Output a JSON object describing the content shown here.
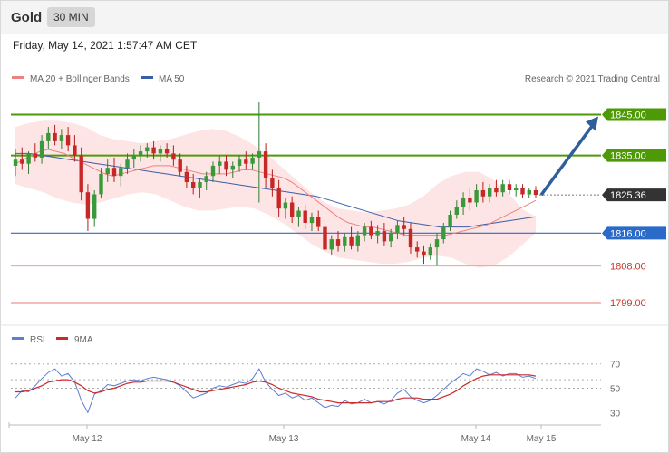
{
  "header": {
    "asset": "Gold",
    "timeframe": "30 MIN",
    "timestamp": "Friday, May 14, 2021 1:57:47 AM CET"
  },
  "legend": {
    "ma20": "MA 20 + Bollinger Bands",
    "ma50": "MA 50",
    "copyright": "Research © 2021 Trading Central",
    "rsi": "RSI",
    "ma9": "9MA"
  },
  "colors": {
    "resistance": "#4e9a06",
    "support": "#2a6ac8",
    "extra_support": "#d9534f",
    "ma20": "#f08080",
    "ma50": "#3b5ea8",
    "bollinger": "#fde0e0",
    "current": "#333333",
    "arrow": "#2f5f9a",
    "rsi": "#5b7fd1",
    "rsi_ma": "#cc2a2a"
  },
  "chart_data": [
    {
      "type": "candlestick",
      "title": "",
      "ylim": [
        1795,
        1852
      ],
      "x_ticks": [
        "May 12",
        "May 13",
        "May 14",
        "May 15"
      ],
      "levels": [
        {
          "label": "1845.00",
          "value": 1845.0,
          "kind": "resistance"
        },
        {
          "label": "1835.00",
          "value": 1835.0,
          "kind": "resistance"
        },
        {
          "label": "1825.36",
          "value": 1825.36,
          "kind": "current"
        },
        {
          "label": "1816.00",
          "value": 1816.0,
          "kind": "support"
        },
        {
          "label": "1808.00",
          "value": 1808.0,
          "kind": "extra_support"
        },
        {
          "label": "1799.00",
          "value": 1799.0,
          "kind": "extra_support"
        }
      ],
      "ohlc": [
        [
          1832.5,
          1836.5,
          1830,
          1834
        ],
        [
          1834,
          1837,
          1831.5,
          1833
        ],
        [
          1833,
          1836,
          1830.5,
          1835.5
        ],
        [
          1835.5,
          1838,
          1833.5,
          1834.5
        ],
        [
          1834.5,
          1840,
          1833,
          1838.5
        ],
        [
          1838.5,
          1842,
          1836.5,
          1840.5
        ],
        [
          1840.5,
          1842.5,
          1837.5,
          1838.5
        ],
        [
          1838.5,
          1841.5,
          1836.5,
          1840
        ],
        [
          1840,
          1842,
          1836,
          1837.5
        ],
        [
          1837.5,
          1840,
          1833.5,
          1835
        ],
        [
          1835,
          1837,
          1824,
          1826
        ],
        [
          1826,
          1828,
          1816.5,
          1819.5
        ],
        [
          1819.5,
          1826.5,
          1817.5,
          1825.5
        ],
        [
          1825.5,
          1832,
          1824.5,
          1830.5
        ],
        [
          1830.5,
          1834,
          1828.5,
          1832
        ],
        [
          1832,
          1834.5,
          1828.5,
          1830
        ],
        [
          1830,
          1833,
          1827.5,
          1832
        ],
        [
          1832,
          1835.5,
          1830.5,
          1834
        ],
        [
          1834,
          1836.5,
          1832,
          1835
        ],
        [
          1835,
          1837.5,
          1833.5,
          1836
        ],
        [
          1836,
          1838,
          1834.5,
          1837
        ],
        [
          1837,
          1838.5,
          1834,
          1835.5
        ],
        [
          1835.5,
          1837.5,
          1833.5,
          1836.5
        ],
        [
          1836.5,
          1838,
          1834.5,
          1835.5
        ],
        [
          1835.5,
          1837.5,
          1832.5,
          1834
        ],
        [
          1834,
          1835.5,
          1830,
          1831
        ],
        [
          1831,
          1832.5,
          1827,
          1828.5
        ],
        [
          1828.5,
          1830.5,
          1825.5,
          1827
        ],
        [
          1827,
          1829.5,
          1824.5,
          1828.5
        ],
        [
          1828.5,
          1831,
          1826.5,
          1830
        ],
        [
          1830,
          1833.5,
          1828.5,
          1832.5
        ],
        [
          1832.5,
          1835,
          1830.5,
          1833.5
        ],
        [
          1833.5,
          1835,
          1830,
          1831.5
        ],
        [
          1831.5,
          1833.5,
          1829.5,
          1832.5
        ],
        [
          1832.5,
          1835,
          1831,
          1834
        ],
        [
          1834,
          1836,
          1831.5,
          1833
        ],
        [
          1833,
          1835.5,
          1831.5,
          1834.5
        ],
        [
          1834.5,
          1848,
          1823.5,
          1836
        ],
        [
          1836,
          1838,
          1827,
          1829.5
        ],
        [
          1829.5,
          1831.5,
          1825,
          1827
        ],
        [
          1827,
          1829,
          1820,
          1822
        ],
        [
          1822,
          1824.5,
          1819.5,
          1823.5
        ],
        [
          1823.5,
          1825,
          1818.5,
          1820
        ],
        [
          1820,
          1822.5,
          1817.5,
          1821.5
        ],
        [
          1821.5,
          1823,
          1817,
          1818.5
        ],
        [
          1818.5,
          1821,
          1816.5,
          1820
        ],
        [
          1820,
          1821.5,
          1816.5,
          1817.5
        ],
        [
          1817.5,
          1818.5,
          1810,
          1812
        ],
        [
          1812,
          1815.5,
          1810.5,
          1814.5
        ],
        [
          1814.5,
          1816.5,
          1811.5,
          1813
        ],
        [
          1813,
          1816,
          1811.5,
          1815
        ],
        [
          1815,
          1817.5,
          1812,
          1813
        ],
        [
          1813,
          1816.5,
          1811.5,
          1815.5
        ],
        [
          1815.5,
          1818.5,
          1814,
          1817.5
        ],
        [
          1817.5,
          1819,
          1814.5,
          1815.5
        ],
        [
          1815.5,
          1818,
          1813.5,
          1816.5
        ],
        [
          1816.5,
          1818.5,
          1813,
          1814
        ],
        [
          1814,
          1817,
          1812.5,
          1816
        ],
        [
          1816,
          1819,
          1814.5,
          1818
        ],
        [
          1818,
          1820,
          1815.5,
          1817
        ],
        [
          1817,
          1818.5,
          1811,
          1812.5
        ],
        [
          1812.5,
          1814,
          1810,
          1811.5
        ],
        [
          1811.5,
          1813,
          1808.5,
          1810.5
        ],
        [
          1810.5,
          1813.5,
          1809.5,
          1812.5
        ],
        [
          1812.5,
          1816,
          1808,
          1814.5
        ],
        [
          1814.5,
          1818.5,
          1813.5,
          1817.5
        ],
        [
          1817.5,
          1821.5,
          1816.5,
          1820.5
        ],
        [
          1820.5,
          1824,
          1819.5,
          1822.5
        ],
        [
          1822.5,
          1826,
          1820.5,
          1824.5
        ],
        [
          1824.5,
          1827,
          1821.5,
          1823.5
        ],
        [
          1823.5,
          1828,
          1822.5,
          1826.5
        ],
        [
          1826.5,
          1828.5,
          1823.5,
          1825
        ],
        [
          1825,
          1828,
          1823.5,
          1827
        ],
        [
          1827,
          1829,
          1825,
          1826
        ],
        [
          1826,
          1829,
          1825,
          1828
        ],
        [
          1828,
          1829,
          1825.5,
          1826.5
        ],
        [
          1826.5,
          1828,
          1825,
          1827
        ],
        [
          1827,
          1828,
          1824.5,
          1825.5
        ],
        [
          1825.5,
          1827,
          1824.5,
          1826.5
        ],
        [
          1826.5,
          1827.5,
          1824.5,
          1825.36
        ]
      ],
      "ma20": [
        1833,
        1834,
        1835,
        1836,
        1836.5,
        1836,
        1835.5,
        1834.5,
        1833.5,
        1832.5,
        1831.5,
        1830.5,
        1830,
        1830.5,
        1831,
        1831.5,
        1832,
        1832.5,
        1832.5,
        1832.5,
        1832,
        1831.5,
        1831,
        1830.5,
        1830.5,
        1830.5,
        1830.5,
        1831,
        1831.5,
        1831.5,
        1831,
        1830.5,
        1830,
        1829.5,
        1828.5,
        1827,
        1825.5,
        1824,
        1822.5,
        1821,
        1819.5,
        1818.5,
        1818,
        1817.5,
        1817.5,
        1817,
        1816.5,
        1816,
        1815.5,
        1815.5,
        1815.5,
        1815.5,
        1815.5,
        1815.5,
        1816,
        1816.5,
        1817,
        1817.5,
        1818,
        1819,
        1820,
        1821,
        1822,
        1823,
        1824
      ],
      "ma50": [
        1835.5,
        1835.5,
        1835,
        1834.5,
        1834,
        1833.5,
        1833,
        1832.5,
        1832,
        1831.5,
        1831,
        1830.5,
        1830,
        1829.5,
        1829,
        1828.5,
        1828,
        1827.5,
        1827,
        1826.5,
        1826,
        1825.5,
        1825,
        1824,
        1823,
        1822,
        1821,
        1820,
        1819,
        1818.5,
        1818,
        1817.5,
        1817.5,
        1817.5,
        1818,
        1818.5,
        1819,
        1819.5,
        1820
      ],
      "bollinger_upper": [
        1842,
        1843,
        1843.5,
        1843.5,
        1843,
        1842,
        1840,
        1839,
        1838.5,
        1838,
        1838.5,
        1839,
        1840,
        1841,
        1841.5,
        1841,
        1839.5,
        1837.5,
        1835,
        1832,
        1829,
        1826,
        1823.5,
        1822,
        1821.5,
        1821,
        1821.5,
        1822,
        1823,
        1825,
        1828,
        1830,
        1831,
        1831,
        1829,
        1826,
        1822,
        1820
      ],
      "bollinger_lower": [
        1828,
        1827,
        1826,
        1824.5,
        1823.5,
        1823,
        1823.5,
        1824.5,
        1825.5,
        1826,
        1825.5,
        1824,
        1822.5,
        1821.5,
        1821.5,
        1822,
        1822.5,
        1822,
        1820.5,
        1818.5,
        1816,
        1813.5,
        1811.5,
        1810,
        1809.5,
        1809,
        1808.5,
        1808.5,
        1809,
        1810,
        1810.5,
        1810,
        1808.5,
        1807.5,
        1808,
        1810,
        1813,
        1816
      ]
    },
    {
      "type": "line",
      "title": "",
      "ylim": [
        22,
        78
      ],
      "y_ticks": [
        30,
        50,
        70
      ],
      "x_ticks": [
        "May 12",
        "May 13",
        "May 14",
        "May 15"
      ],
      "series": [
        {
          "name": "RSI",
          "values": [
            42,
            48,
            47,
            52,
            58,
            63,
            66,
            60,
            62,
            55,
            40,
            30,
            45,
            48,
            53,
            52,
            54,
            56,
            57,
            56,
            58,
            59,
            58,
            57,
            55,
            52,
            47,
            42,
            44,
            46,
            50,
            52,
            51,
            53,
            55,
            54,
            58,
            66,
            55,
            49,
            44,
            46,
            42,
            44,
            40,
            42,
            38,
            34,
            36,
            35,
            40,
            37,
            38,
            41,
            38,
            39,
            37,
            40,
            46,
            49,
            43,
            40,
            38,
            40,
            44,
            49,
            54,
            58,
            62,
            60,
            66,
            64,
            61,
            63,
            60,
            62,
            62,
            59,
            60,
            58
          ]
        },
        {
          "name": "9MA",
          "values": [
            47,
            47,
            48,
            50,
            52,
            55,
            56,
            57,
            57,
            55,
            52,
            48,
            46,
            47,
            49,
            50,
            52,
            54,
            55,
            55,
            56,
            56,
            56,
            56,
            55,
            53,
            51,
            49,
            47,
            47,
            48,
            49,
            50,
            51,
            52,
            53,
            55,
            56,
            55,
            53,
            50,
            48,
            46,
            45,
            44,
            43,
            41,
            40,
            39,
            38,
            38,
            38,
            38,
            38,
            38,
            39,
            39,
            39,
            41,
            42,
            42,
            42,
            41,
            41,
            41,
            43,
            45,
            48,
            52,
            55,
            58,
            60,
            61,
            61,
            61,
            61,
            61,
            61,
            61,
            60
          ]
        }
      ]
    }
  ]
}
